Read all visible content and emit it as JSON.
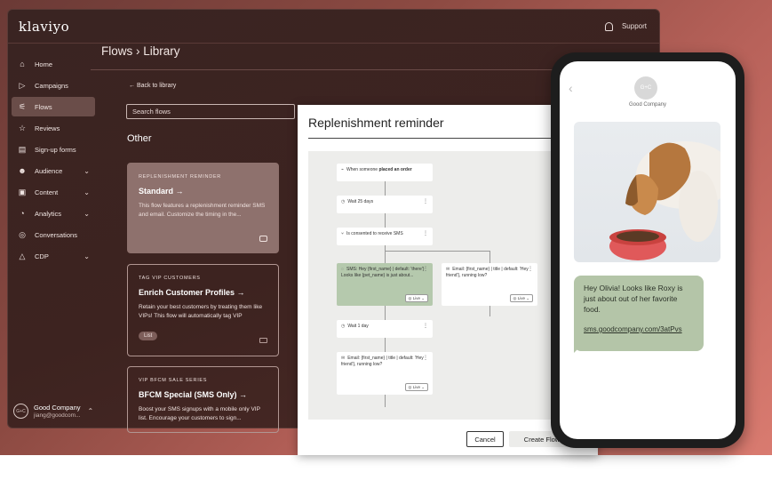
{
  "app": {
    "logo": "klaviyo",
    "support_label": "Support",
    "icons": {
      "bell": "bell-icon"
    }
  },
  "sidebar": {
    "items": [
      {
        "label": "Home",
        "icon": "home-icon",
        "glyph": "⌂",
        "chevron": false,
        "active": false
      },
      {
        "label": "Campaigns",
        "icon": "send-icon",
        "glyph": "▷",
        "chevron": false,
        "active": false
      },
      {
        "label": "Flows",
        "icon": "flow-icon",
        "glyph": "⚟",
        "chevron": false,
        "active": true
      },
      {
        "label": "Reviews",
        "icon": "star-icon",
        "glyph": "☆",
        "chevron": false,
        "active": false
      },
      {
        "label": "Sign-up forms",
        "icon": "form-icon",
        "glyph": "▤",
        "chevron": false,
        "active": false
      },
      {
        "label": "Audience",
        "icon": "people-icon",
        "glyph": "☻",
        "chevron": true,
        "active": false
      },
      {
        "label": "Content",
        "icon": "content-icon",
        "glyph": "▣",
        "chevron": true,
        "active": false
      },
      {
        "label": "Analytics",
        "icon": "analytics-icon",
        "glyph": "◔",
        "chevron": true,
        "active": false
      },
      {
        "label": "Conversations",
        "icon": "chat-icon",
        "glyph": "◎",
        "chevron": false,
        "active": false
      },
      {
        "label": "CDP",
        "icon": "cdp-icon",
        "glyph": "△",
        "chevron": true,
        "active": false
      }
    ],
    "account": {
      "avatar": "G+C",
      "name": "Good Company",
      "email": "jiang@goodcom..."
    }
  },
  "main": {
    "breadcrumb": "Flows › Library",
    "back_link": "←  Back to library",
    "search_placeholder": "Search flows",
    "section_title": "Other",
    "cards": [
      {
        "eyebrow": "REPLENISHMENT REMINDER",
        "title": "Standard →",
        "description": "This flow features a replenishment reminder SMS and email. Customize the timing in the...",
        "tag": ""
      },
      {
        "eyebrow": "TAG VIP CUSTOMERS",
        "title": "Enrich Customer Profiles →",
        "description": "Retain your best customers by treating them like VIPs! This flow will automatically tag VIP",
        "tag": "List"
      },
      {
        "eyebrow": "VIP BFCM SALE SERIES",
        "title": "BFCM Special (SMS Only) →",
        "description": "Boost your SMS signups with a mobile only VIP list. Encourage your customers to sign...",
        "tag": ""
      }
    ]
  },
  "flow_panel": {
    "title": "Replenishment reminder",
    "nodes": {
      "trigger_prefix": "When someone ",
      "trigger_bold": "placed an order",
      "wait1": "Wait 25 days",
      "split": "Is consented to receive SMS",
      "sms": "SMS: Hey {first_name} | default: 'there'} Looks like {pet_name} is just about...",
      "email1": "Email: {first_name} | title | default: 'Hey friend'}, running low?",
      "wait2": "Wait 1 day",
      "email2": "Email: {first_name} | title | default: 'Hey friend'}, running low?",
      "live": "Live"
    },
    "cancel_label": "Cancel",
    "create_label": "Create Flow"
  },
  "phone": {
    "avatar": "G+C",
    "sender": "Good Company",
    "message": "Hey Olivia! Looks like Roxy is just about out of her favorite food.",
    "link": "sms.goodcompany.com/3atPvs"
  }
}
